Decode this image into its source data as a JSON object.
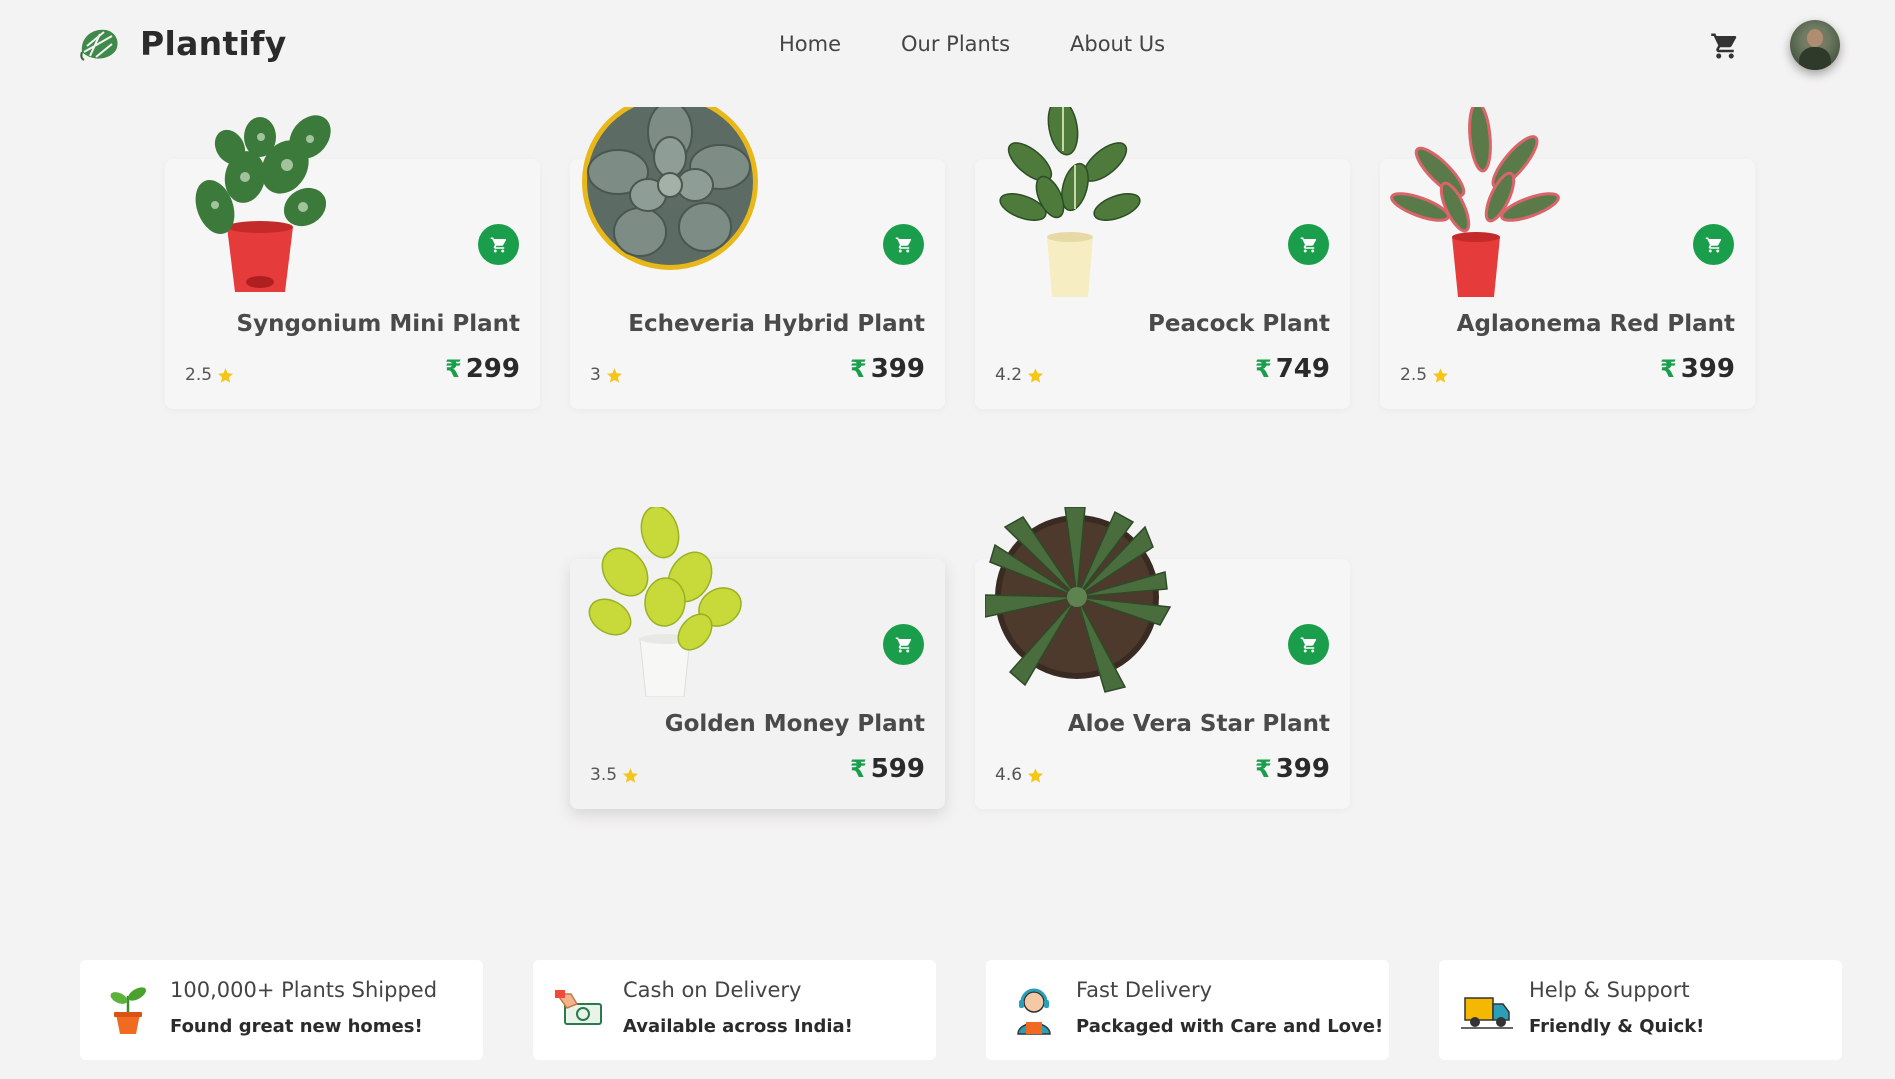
{
  "brand": {
    "name": "Plantify",
    "logo_icon": "monstera-leaf-icon"
  },
  "nav": {
    "items": [
      "Home",
      "Our Plants",
      "About Us"
    ]
  },
  "header": {
    "cart_icon": "cart-icon",
    "avatar_icon": "user-avatar"
  },
  "currency_symbol": "₹",
  "accent_color": "#1b9e4b",
  "star_color": "#f5c518",
  "products": [
    {
      "name": "Syngonium Mini Plant",
      "rating": "2.5",
      "price": "299",
      "pot": "red"
    },
    {
      "name": "Echeveria Hybrid Plant",
      "rating": "3",
      "price": "399",
      "pot": "yellow"
    },
    {
      "name": "Peacock Plant",
      "rating": "4.2",
      "price": "749",
      "pot": "cream"
    },
    {
      "name": "Aglaonema Red Plant",
      "rating": "2.5",
      "price": "399",
      "pot": "red"
    },
    {
      "name": "Golden Money Plant",
      "rating": "3.5",
      "price": "599",
      "pot": "white"
    },
    {
      "name": "Aloe Vera Star Plant",
      "rating": "4.6",
      "price": "399",
      "pot": "brown"
    }
  ],
  "features": [
    {
      "title": "100,000+ Plants Shipped",
      "subtitle": "Found great new homes!",
      "icon": "potted-plant-icon"
    },
    {
      "title": "Cash on Delivery",
      "subtitle": "Available across India!",
      "icon": "cash-hand-icon"
    },
    {
      "title": "Fast Delivery",
      "subtitle": "Packaged with Care and Love!",
      "icon": "support-agent-icon"
    },
    {
      "title": "Help & Support",
      "subtitle": "Friendly & Quick!",
      "icon": "delivery-truck-icon"
    }
  ]
}
